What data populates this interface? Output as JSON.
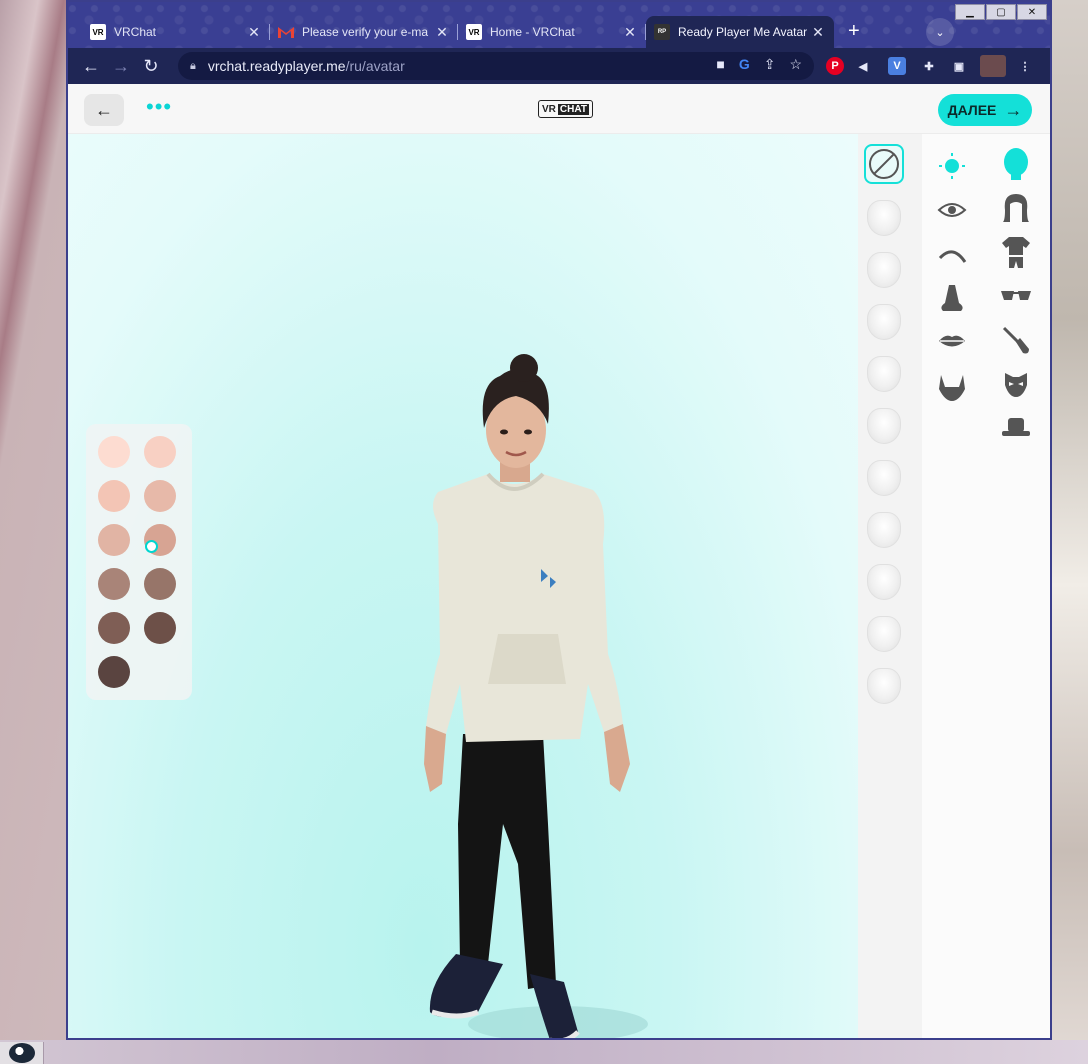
{
  "browser": {
    "tabs": [
      {
        "title": "VRChat",
        "favicon": "vrchat-icon",
        "active": false
      },
      {
        "title": "Please verify your e-ma",
        "favicon": "gmail-icon",
        "active": false
      },
      {
        "title": "Home - VRChat",
        "favicon": "vrchat-icon",
        "active": false
      },
      {
        "title": "Ready Player Me Avatar",
        "favicon": "readyplayerme-icon",
        "active": true
      }
    ],
    "new_tab": "+",
    "url_host": "vrchat.readyplayer.me",
    "url_path": "/ru/avatar"
  },
  "page": {
    "logo_vr": "VR",
    "logo_chat": "CHAT",
    "next_label": "ДАЛЕЕ",
    "accent": "#14e0d8"
  },
  "skin_swatches": [
    "#fddcd1",
    "#f8d0c3",
    "#f3c5b5",
    "#e7b9a9",
    "#e1b4a4",
    "#d7a493",
    "#a98478",
    "#977569",
    "#7f5e55",
    "#6d5048",
    "#5a4440"
  ],
  "selected_swatch": 5,
  "presets": {
    "none_icon": "no-selection-icon",
    "count": 10
  },
  "categories": {
    "left": [
      "skin-tone-icon",
      "eye-icon",
      "eyebrow-icon",
      "nose-icon",
      "lips-icon",
      "beard-icon"
    ],
    "right": [
      "head-icon",
      "hair-icon",
      "outfit-icon",
      "glasses-icon",
      "makeup-brush-icon",
      "face-mask-icon",
      "hat-icon"
    ]
  }
}
